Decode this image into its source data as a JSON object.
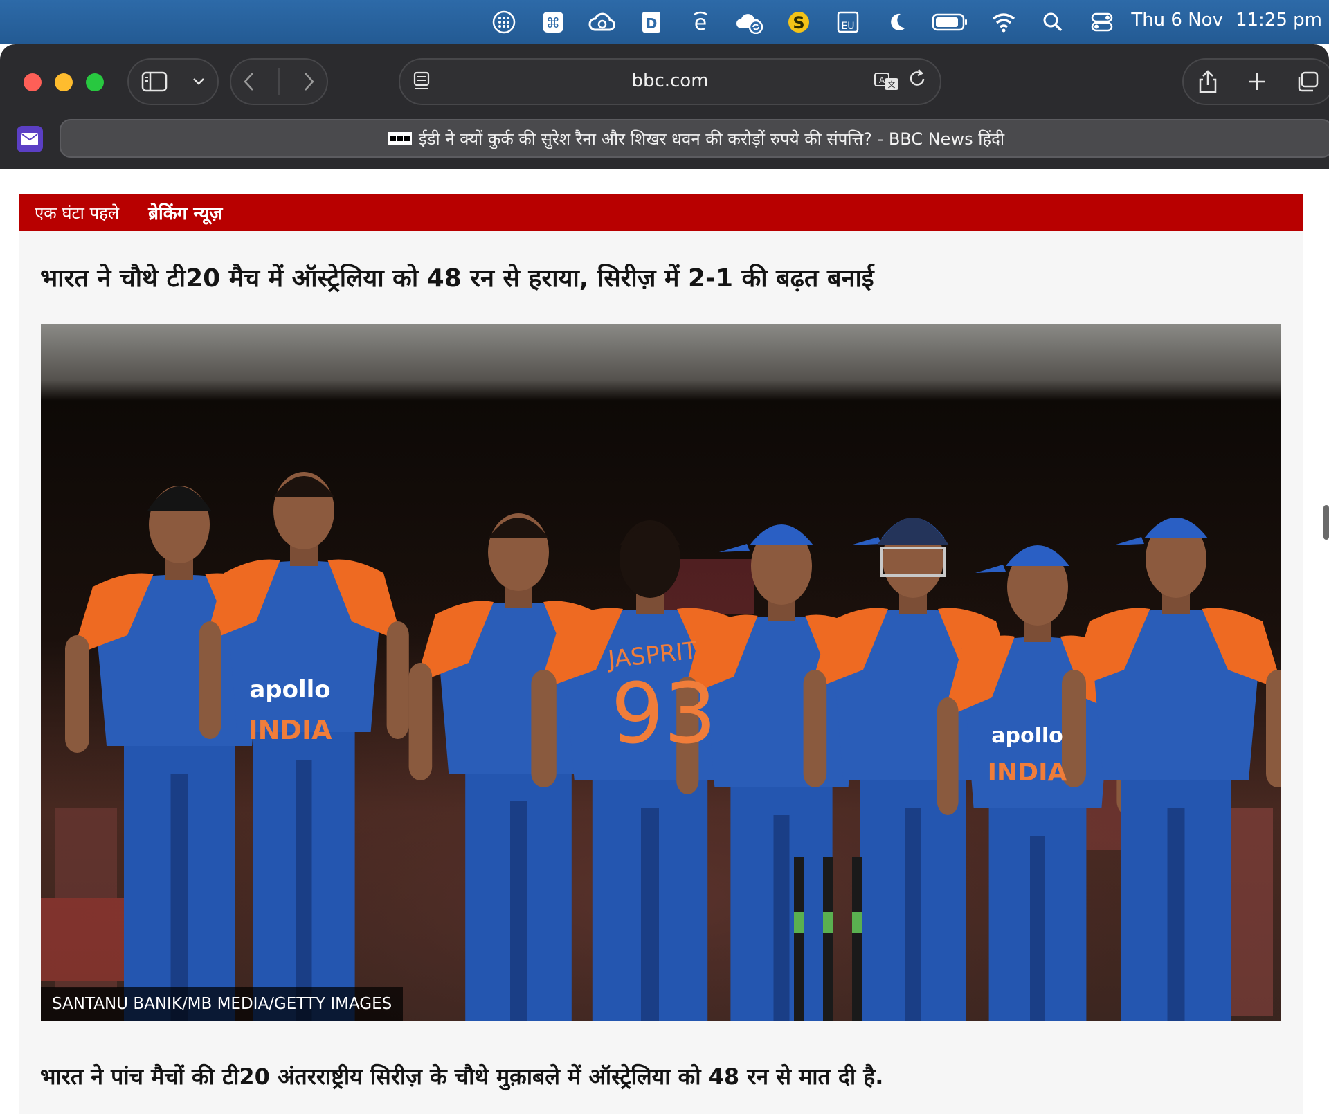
{
  "menubar": {
    "icons": [
      "launchpad-icon",
      "command-icon",
      "creative-cloud-icon",
      "dash-icon",
      "edge-icon",
      "cloud-sync-icon",
      "dollar-icon",
      "eu-icon",
      "moon-icon",
      "battery-icon",
      "wifi-icon",
      "spotlight-icon",
      "control-center-icon"
    ],
    "day": "Thu 6 Nov",
    "time": "11:25 pm"
  },
  "browser": {
    "address": "bbc.com",
    "tab_title": "ईडी ने क्यों कुर्क की सुरेश रैना और शिखर धवन की करोड़ों रुपये की संपत्ति? - BBC News हिंदी"
  },
  "page": {
    "breaking_time": "एक घंटा पहले",
    "breaking_label": "ब्रेकिंग न्यूज़",
    "headline": "भारत ने चौथे टी20 मैच में ऑस्ट्रेलिया को 48 रन से हराया, सिरीज़ में 2-1 की बढ़त बनाई",
    "image_credit": "SANTANU BANIK/MB MEDIA/GETTY IMAGES",
    "jersey_sponsor": "apollo",
    "jersey_team": "INDIA",
    "jersey_name": "JASPRIT",
    "jersey_number": "93",
    "summary": "भारत ने पांच मैचों की टी20 अंतरराष्ट्रीय सिरीज़ के चौथे मुक़ाबले में ऑस्ट्रेलिया को 48 रन से मात दी है."
  },
  "colors": {
    "menubar": "#2d6aa8",
    "breaking": "#b80000",
    "jersey_blue": "#2a5db8",
    "jersey_orange": "#ee6a22"
  }
}
